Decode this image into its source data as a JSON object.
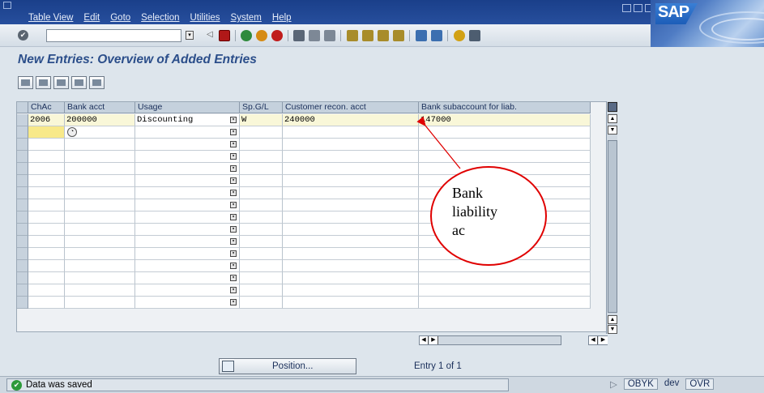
{
  "menu": {
    "items": [
      "Table View",
      "Edit",
      "Goto",
      "Selection",
      "Utilities",
      "System",
      "Help"
    ]
  },
  "brand": "SAP",
  "page_title": "New Entries: Overview of Added Entries",
  "table": {
    "columns": [
      "ChAc",
      "Bank acct",
      "Usage",
      "Sp.G/L",
      "Customer recon. acct",
      "Bank subaccount for liab."
    ],
    "rows": [
      [
        "2006",
        "200000",
        "Discounting",
        "W",
        "240000",
        "147000"
      ]
    ],
    "empty_row_count": 15
  },
  "annotation": {
    "lines": [
      "Bank",
      "liability",
      "ac"
    ],
    "color": "#e00000"
  },
  "position_button": "Position...",
  "entry_info": "Entry 1 of 1",
  "status": {
    "message": "Data was saved",
    "transaction": "OBYK",
    "server": "dev",
    "mode": "OVR"
  }
}
